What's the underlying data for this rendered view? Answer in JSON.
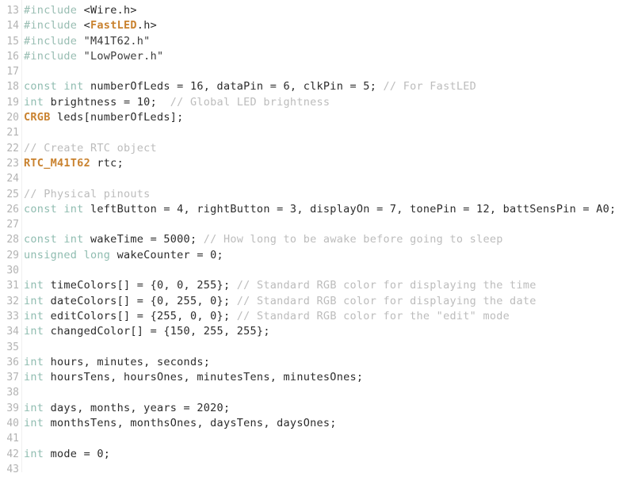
{
  "editor": {
    "language": "arduino-cpp",
    "first_line_number": 13,
    "last_line_number": 43,
    "background_color": "#ffffff",
    "gutter_color": "#b3b3b3",
    "default_text_color": "#2b2b2b",
    "keyword_color": "#8fbcb0",
    "comment_color": "#bcbcbc",
    "type_color": "#c9822f"
  },
  "lines": [
    {
      "number": "13",
      "tokens": [
        {
          "t": "#include ",
          "c": "tok-pre"
        },
        {
          "t": "<",
          "c": "tok-plain"
        },
        {
          "t": "Wire",
          "c": "tok-plain"
        },
        {
          "t": ".h>",
          "c": "tok-plain"
        }
      ]
    },
    {
      "number": "14",
      "tokens": [
        {
          "t": "#include ",
          "c": "tok-pre"
        },
        {
          "t": "<",
          "c": "tok-plain"
        },
        {
          "t": "FastLED",
          "c": "tok-class"
        },
        {
          "t": ".h>",
          "c": "tok-plain"
        }
      ]
    },
    {
      "number": "15",
      "tokens": [
        {
          "t": "#include ",
          "c": "tok-pre"
        },
        {
          "t": "\"M41T62.h\"",
          "c": "tok-str"
        }
      ]
    },
    {
      "number": "16",
      "tokens": [
        {
          "t": "#include ",
          "c": "tok-pre"
        },
        {
          "t": "\"LowPower.h\"",
          "c": "tok-str"
        }
      ]
    },
    {
      "number": "17",
      "tokens": []
    },
    {
      "number": "18",
      "tokens": [
        {
          "t": "const int",
          "c": "tok-kw"
        },
        {
          "t": " numberOfLeds = 16, dataPin = 6, clkPin = 5; ",
          "c": "tok-plain"
        },
        {
          "t": "// For FastLED",
          "c": "tok-comment"
        }
      ]
    },
    {
      "number": "19",
      "tokens": [
        {
          "t": "int",
          "c": "tok-kw"
        },
        {
          "t": " brightness = 10;  ",
          "c": "tok-plain"
        },
        {
          "t": "// Global LED brightness",
          "c": "tok-comment"
        }
      ]
    },
    {
      "number": "20",
      "tokens": [
        {
          "t": "CRGB",
          "c": "tok-class"
        },
        {
          "t": " leds[numberOfLeds];",
          "c": "tok-plain"
        }
      ]
    },
    {
      "number": "21",
      "tokens": []
    },
    {
      "number": "22",
      "tokens": [
        {
          "t": "// Create RTC object",
          "c": "tok-comment"
        }
      ]
    },
    {
      "number": "23",
      "tokens": [
        {
          "t": "RTC_M41T62",
          "c": "tok-class"
        },
        {
          "t": " rtc;",
          "c": "tok-plain"
        }
      ]
    },
    {
      "number": "24",
      "tokens": []
    },
    {
      "number": "25",
      "tokens": [
        {
          "t": "// Physical pinouts",
          "c": "tok-comment"
        }
      ]
    },
    {
      "number": "26",
      "tokens": [
        {
          "t": "const int",
          "c": "tok-kw"
        },
        {
          "t": " leftButton = 4, rightButton = 3, displayOn = 7, tonePin = 12, battSensPin = A0;",
          "c": "tok-plain"
        }
      ]
    },
    {
      "number": "27",
      "tokens": []
    },
    {
      "number": "28",
      "tokens": [
        {
          "t": "const int",
          "c": "tok-kw"
        },
        {
          "t": " wakeTime = 5000; ",
          "c": "tok-plain"
        },
        {
          "t": "// How long to be awake before going to sleep",
          "c": "tok-comment"
        }
      ]
    },
    {
      "number": "29",
      "tokens": [
        {
          "t": "unsigned long",
          "c": "tok-kw"
        },
        {
          "t": " wakeCounter = 0;",
          "c": "tok-plain"
        }
      ]
    },
    {
      "number": "30",
      "tokens": []
    },
    {
      "number": "31",
      "tokens": [
        {
          "t": "int",
          "c": "tok-kw"
        },
        {
          "t": " timeColors[] = {0, 0, 255}; ",
          "c": "tok-plain"
        },
        {
          "t": "// Standard RGB color for displaying the time",
          "c": "tok-comment"
        }
      ]
    },
    {
      "number": "32",
      "tokens": [
        {
          "t": "int",
          "c": "tok-kw"
        },
        {
          "t": " dateColors[] = {0, 255, 0}; ",
          "c": "tok-plain"
        },
        {
          "t": "// Standard RGB color for displaying the date",
          "c": "tok-comment"
        }
      ]
    },
    {
      "number": "33",
      "tokens": [
        {
          "t": "int",
          "c": "tok-kw"
        },
        {
          "t": " editColors[] = {255, 0, 0}; ",
          "c": "tok-plain"
        },
        {
          "t": "// Standard RGB color for the \"edit\" mode",
          "c": "tok-comment"
        }
      ]
    },
    {
      "number": "34",
      "tokens": [
        {
          "t": "int",
          "c": "tok-kw"
        },
        {
          "t": " changedColor[] = {150, 255, 255};",
          "c": "tok-plain"
        }
      ]
    },
    {
      "number": "35",
      "tokens": []
    },
    {
      "number": "36",
      "tokens": [
        {
          "t": "int",
          "c": "tok-kw"
        },
        {
          "t": " hours, minutes, seconds;",
          "c": "tok-plain"
        }
      ]
    },
    {
      "number": "37",
      "tokens": [
        {
          "t": "int",
          "c": "tok-kw"
        },
        {
          "t": " hoursTens, hoursOnes, minutesTens, minutesOnes;",
          "c": "tok-plain"
        }
      ]
    },
    {
      "number": "38",
      "tokens": []
    },
    {
      "number": "39",
      "tokens": [
        {
          "t": "int",
          "c": "tok-kw"
        },
        {
          "t": " days, months, years = 2020;",
          "c": "tok-plain"
        }
      ]
    },
    {
      "number": "40",
      "tokens": [
        {
          "t": "int",
          "c": "tok-kw"
        },
        {
          "t": " monthsTens, monthsOnes, daysTens, daysOnes;",
          "c": "tok-plain"
        }
      ]
    },
    {
      "number": "41",
      "tokens": []
    },
    {
      "number": "42",
      "tokens": [
        {
          "t": "int",
          "c": "tok-kw"
        },
        {
          "t": " mode = 0;",
          "c": "tok-plain"
        }
      ]
    },
    {
      "number": "43",
      "tokens": []
    }
  ]
}
